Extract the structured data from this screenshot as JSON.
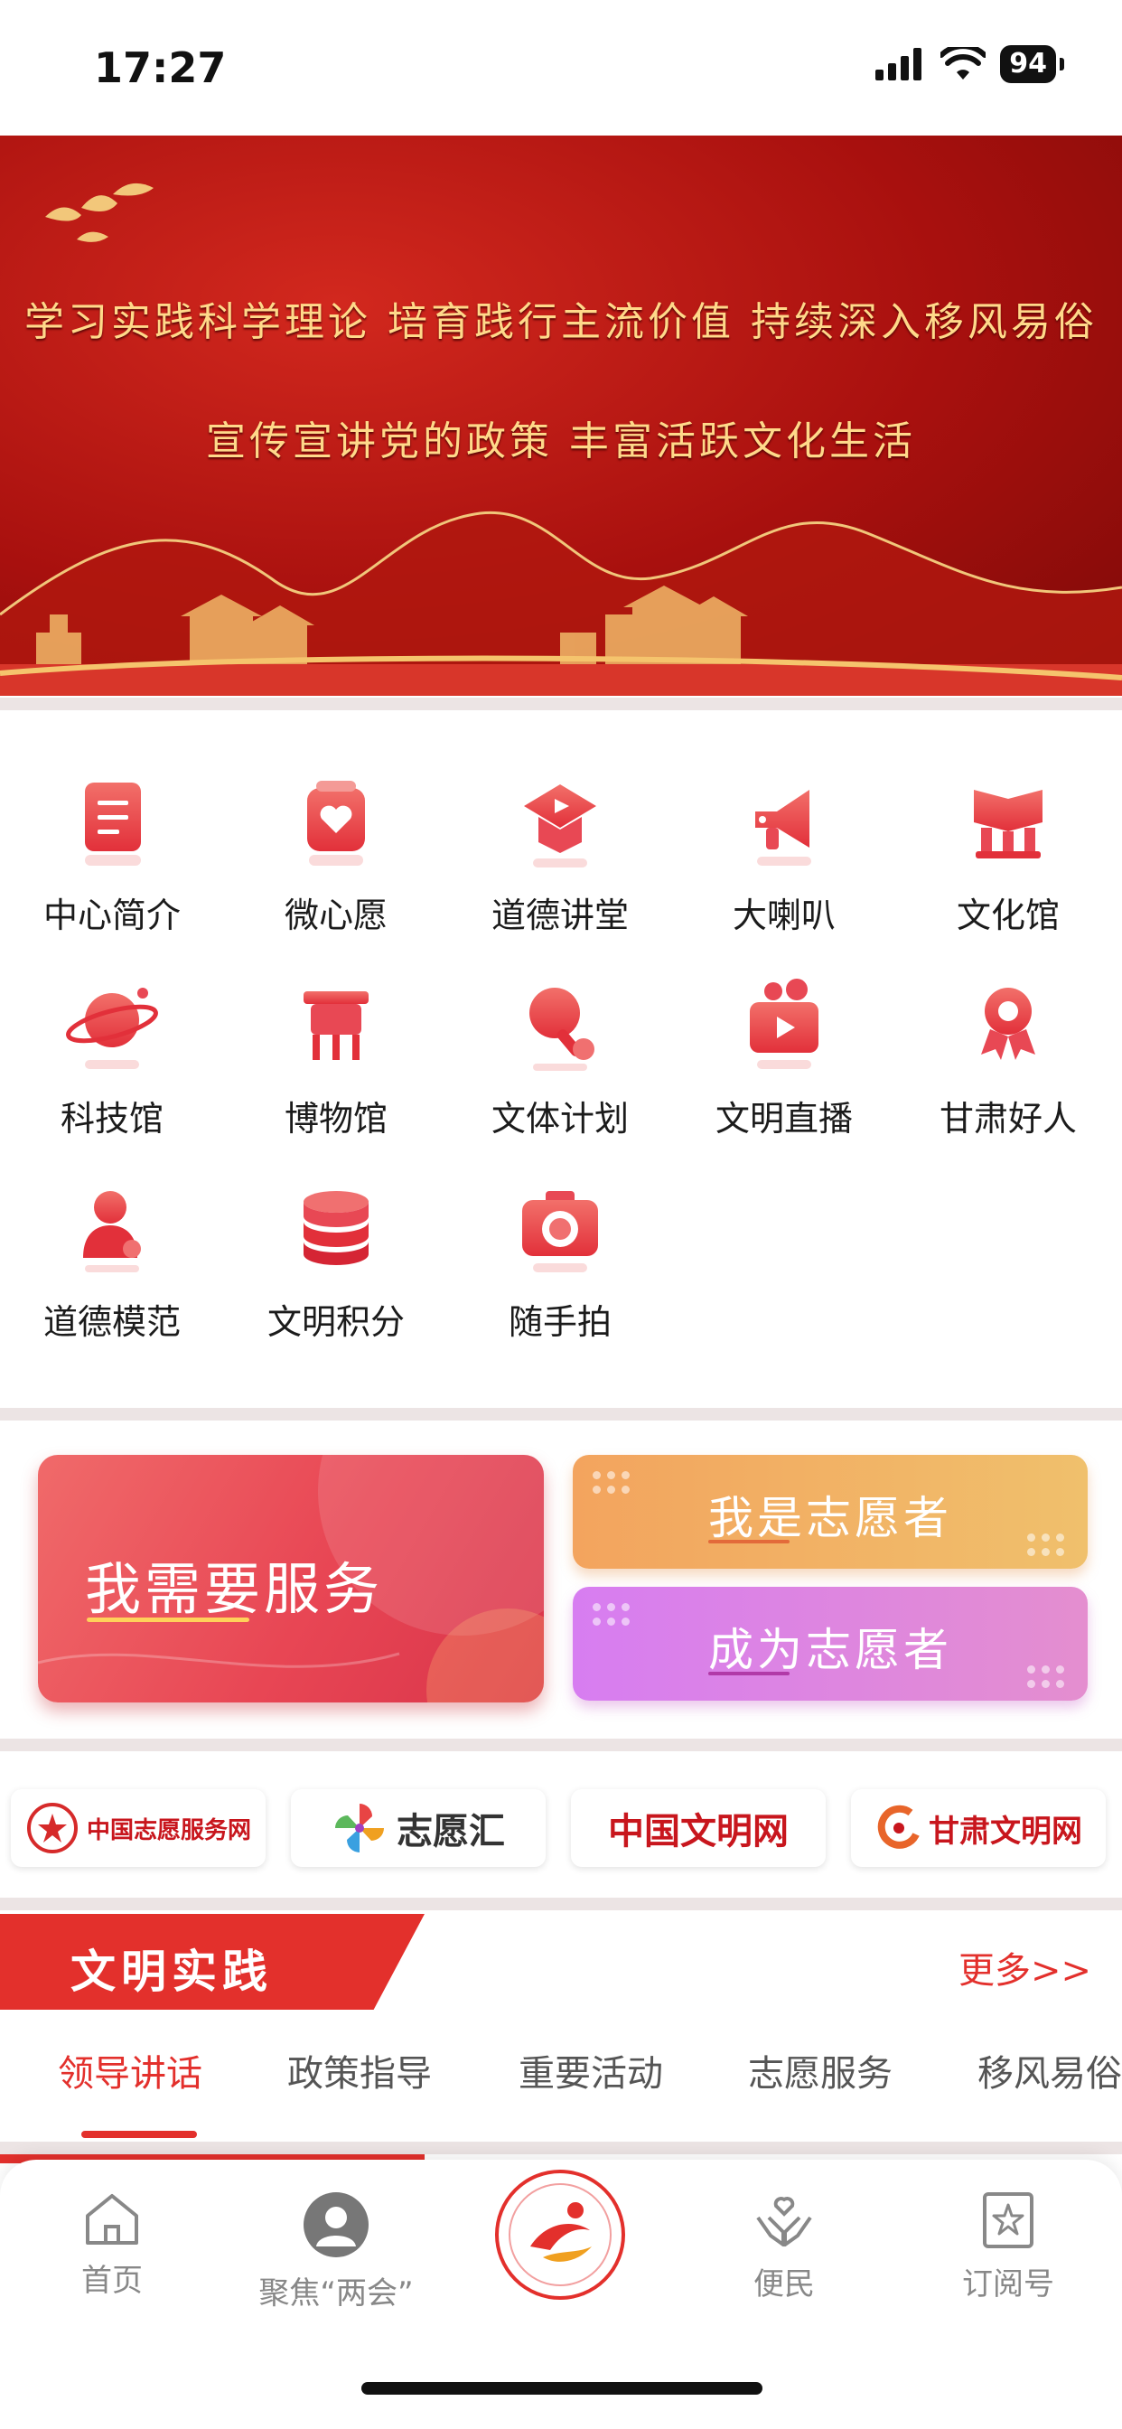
{
  "status": {
    "time": "17:27",
    "battery": "94"
  },
  "banner": {
    "line1": "学习实践科学理论  培育践行主流价值  持续深入移风易俗",
    "line2": "宣传宣讲党的政策      丰富活跃文化生活"
  },
  "menu": [
    {
      "label": "中心简介",
      "icon": "document-icon"
    },
    {
      "label": "微心愿",
      "icon": "heart-card-icon"
    },
    {
      "label": "道德讲堂",
      "icon": "graduation-play-icon"
    },
    {
      "label": "大喇叭",
      "icon": "megaphone-icon"
    },
    {
      "label": "文化馆",
      "icon": "book-building-icon"
    },
    {
      "label": "科技馆",
      "icon": "planet-icon"
    },
    {
      "label": "博物馆",
      "icon": "ding-vessel-icon"
    },
    {
      "label": "文体计划",
      "icon": "ping-pong-icon"
    },
    {
      "label": "文明直播",
      "icon": "video-camera-icon"
    },
    {
      "label": "甘肃好人",
      "icon": "award-person-icon"
    },
    {
      "label": "道德模范",
      "icon": "person-badge-icon"
    },
    {
      "label": "文明积分",
      "icon": "database-icon"
    },
    {
      "label": "随手拍",
      "icon": "camera-icon"
    }
  ],
  "services": {
    "need": "我需要服务",
    "volunteer": "我是志愿者",
    "become": "成为志愿者"
  },
  "partners": [
    "中国志愿服务网",
    "志愿汇",
    "中国文明网",
    "甘肃文明网"
  ],
  "section": {
    "title": "文明实践",
    "more": "更多>>"
  },
  "tabs": [
    "领导讲话",
    "政策指导",
    "重要活动",
    "志愿服务",
    "移风易俗"
  ],
  "tabbar": [
    {
      "label": "首页",
      "icon": "home-icon"
    },
    {
      "label": "聚焦“两会”",
      "icon": "avatar-icon"
    },
    {
      "label": "",
      "icon": "center-logo-icon"
    },
    {
      "label": "便民",
      "icon": "hands-heart-icon"
    },
    {
      "label": "订阅号",
      "icon": "star-bookmark-icon"
    }
  ],
  "colors": {
    "accent": "#e3302c",
    "banner": "#a8100e"
  }
}
